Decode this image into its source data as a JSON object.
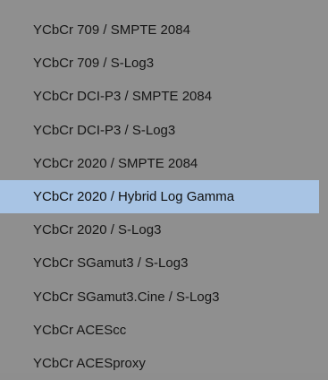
{
  "menu": {
    "selected_index": 5,
    "colors": {
      "background": "#8f8f8f",
      "selected_background": "#a8c4e4",
      "text": "#151515"
    },
    "items": [
      {
        "label": "YCbCr 709 / SMPTE 2084"
      },
      {
        "label": "YCbCr 709 / S-Log3"
      },
      {
        "label": "YCbCr DCI-P3 / SMPTE 2084"
      },
      {
        "label": "YCbCr DCI-P3 / S-Log3"
      },
      {
        "label": "YCbCr 2020 / SMPTE 2084"
      },
      {
        "label": "YCbCr 2020 / Hybrid Log Gamma"
      },
      {
        "label": "YCbCr 2020 / S-Log3"
      },
      {
        "label": "YCbCr SGamut3 / S-Log3"
      },
      {
        "label": "YCbCr SGamut3.Cine / S-Log3"
      },
      {
        "label": "YCbCr ACEScc"
      },
      {
        "label": "YCbCr ACESproxy"
      }
    ]
  }
}
